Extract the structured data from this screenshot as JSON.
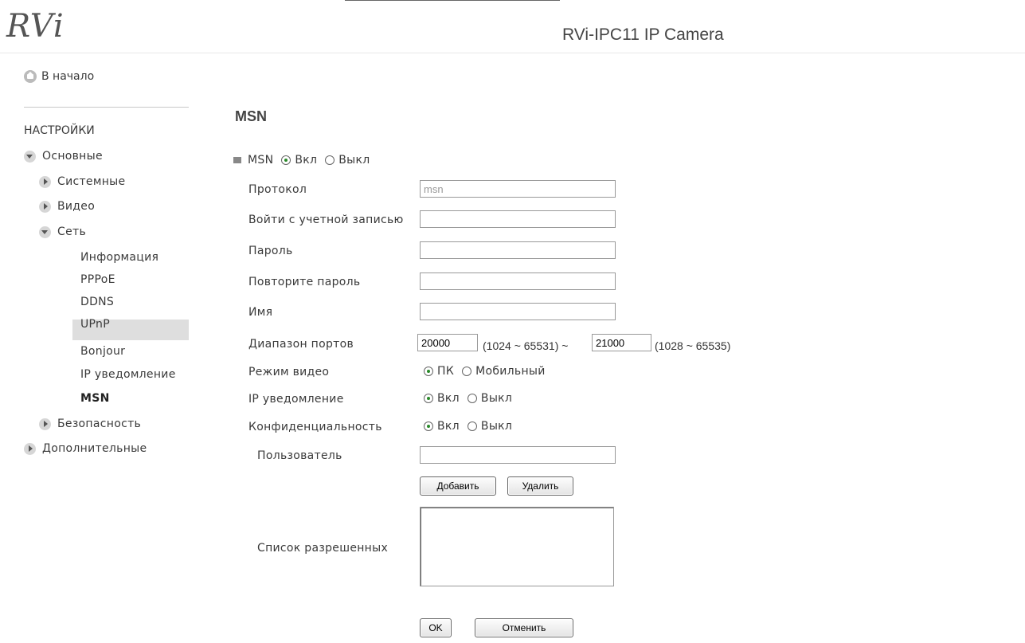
{
  "header": {
    "logo_text": "RVi",
    "title": "RVi-IPC11 IP Camera"
  },
  "sidebar": {
    "home_label": "В начало",
    "section_heading": "НАСТРОЙКИ",
    "basic": {
      "label": "Основные"
    },
    "system": {
      "label": "Системные"
    },
    "video": {
      "label": "Видео"
    },
    "network": {
      "label": "Сеть"
    },
    "network_items": [
      "Информация",
      "PPPoE",
      "DDNS",
      "UPnP",
      "Bonjour",
      "IP уведомление",
      "MSN"
    ],
    "active_item": "MSN",
    "security": {
      "label": "Безопасность"
    },
    "advanced": {
      "label": "Дополнительные"
    }
  },
  "main": {
    "title": "MSN",
    "msn_toggle": {
      "label": "MSN",
      "on": "Вкл",
      "off": "Выкл",
      "selected": "on"
    },
    "protocol": {
      "label": "Протокол",
      "value": "msn"
    },
    "login": {
      "label": "Войти с учетной записью",
      "value": ""
    },
    "password": {
      "label": "Пароль",
      "value": ""
    },
    "password_repeat": {
      "label": "Повторите пароль",
      "value": ""
    },
    "name": {
      "label": "Имя",
      "value": ""
    },
    "port_range": {
      "label": "Диапазон портов",
      "start_value": "20000",
      "start_hint": "(1024 ~ 65531) ~",
      "end_value": "21000",
      "end_hint": "(1028 ~ 65535)"
    },
    "video_mode": {
      "label": "Режим видео",
      "opt1": "ПК",
      "opt2": "Мобильный",
      "selected": "ПК"
    },
    "ip_notify": {
      "label": "IP уведомление",
      "on": "Вкл",
      "off": "Выкл",
      "selected": "on"
    },
    "privacy": {
      "label": "Конфиденциальность",
      "on": "Вкл",
      "off": "Выкл",
      "selected": "on"
    },
    "user": {
      "label": "Пользователь",
      "value": ""
    },
    "add_button": "Добавить",
    "delete_button": "Удалить",
    "allowed_list": {
      "label": "Список разрешенных",
      "items": []
    },
    "ok_button": "OK",
    "cancel_button": "Отменить"
  }
}
